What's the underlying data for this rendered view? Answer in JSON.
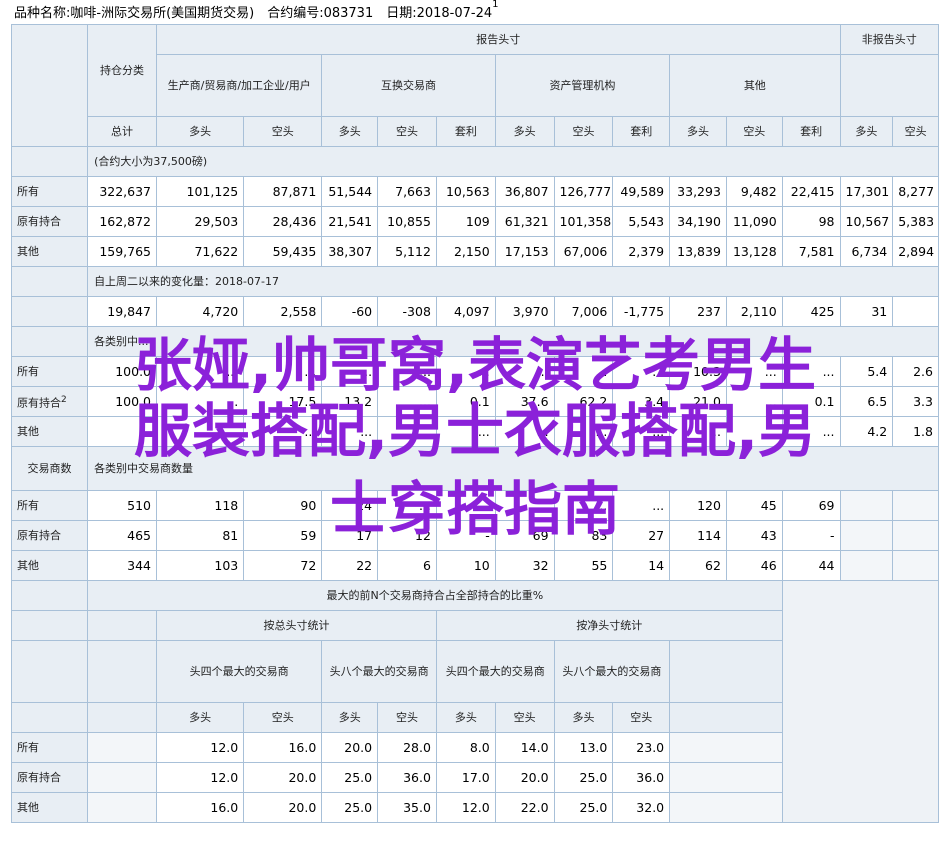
{
  "header": {
    "text": "品种名称:咖啡-洲际交易所(美国期货交易)　合约编号:083731　日期:2018-07-24",
    "marker": "1"
  },
  "col_headers": {
    "holding_class": "持仓分类",
    "reportable": "报告头寸",
    "non_reportable": "非报告头寸",
    "producer": "生产商/贸易商/加工企业/用户",
    "swap": "互换交易商",
    "managed_money": "资产管理机构",
    "other": "其他",
    "total": "总计",
    "long": "多头",
    "short": "空头",
    "spread": "套利"
  },
  "section1": {
    "note": "(合约大小为37,500磅)",
    "rows": [
      {
        "label": "所有",
        "values": [
          "322,637",
          "101,125",
          "87,871",
          "51,544",
          "7,663",
          "10,563",
          "36,807",
          "126,777",
          "49,589",
          "33,293",
          "9,482",
          "22,415",
          "17,301",
          "8,277"
        ]
      },
      {
        "label": "原有持合",
        "values": [
          "162,872",
          "29,503",
          "28,436",
          "21,541",
          "10,855",
          "109",
          "61,321",
          "101,358",
          "5,543",
          "34,190",
          "11,090",
          "98",
          "10,567",
          "5,383"
        ]
      },
      {
        "label": "其他",
        "values": [
          "159,765",
          "71,622",
          "59,435",
          "38,307",
          "5,112",
          "2,150",
          "17,153",
          "67,006",
          "2,379",
          "13,839",
          "13,128",
          "7,581",
          "6,734",
          "2,894"
        ]
      }
    ]
  },
  "section2": {
    "note": "自上周二以来的变化量：2018-07-17",
    "values": [
      "19,847",
      "4,720",
      "2,558",
      "-60",
      "-308",
      "4,097",
      "3,970",
      "7,006",
      "-1,775",
      "237",
      "2,110",
      "425",
      "31"
    ]
  },
  "section3": {
    "note": "各类别中...",
    "rows": [
      {
        "label": "所有",
        "values": [
          "100.0",
          "...",
          "...",
          "...",
          "...",
          "...",
          "...",
          "...",
          "...",
          "10.3",
          "...",
          "...",
          "5.4",
          "2.6"
        ]
      },
      {
        "label": "原有持合",
        "marker": "2",
        "values": [
          "100.0",
          "...",
          "17.5",
          "13.2",
          "...",
          "0.1",
          "37.6",
          "62.2",
          "3.4",
          "21.0",
          "...",
          "0.1",
          "6.5",
          "3.3"
        ]
      },
      {
        "label": "其他",
        "values": [
          "...",
          "...",
          "...",
          "...",
          "...",
          "...",
          "...",
          "...",
          "...",
          "...",
          "...",
          "...",
          "4.2",
          "1.8"
        ]
      }
    ]
  },
  "section4": {
    "left_header": "交易商数",
    "note": "各类别中交易商数量",
    "rows": [
      {
        "label": "所有",
        "values": [
          "510",
          "118",
          "90",
          "24",
          "...",
          "...",
          "...",
          "...",
          "...",
          "120",
          "45",
          "69",
          "",
          ""
        ]
      },
      {
        "label": "原有持合",
        "values": [
          "465",
          "81",
          "59",
          "17",
          "12",
          "-",
          "69",
          "83",
          "27",
          "114",
          "43",
          "-",
          "",
          ""
        ]
      },
      {
        "label": "其他",
        "values": [
          "344",
          "103",
          "72",
          "22",
          "6",
          "10",
          "32",
          "55",
          "14",
          "62",
          "46",
          "44",
          "",
          ""
        ]
      }
    ]
  },
  "section5": {
    "title": "最大的前N个交易商持合占全部持合的比重%",
    "by_gross": "按总头寸统计",
    "by_net": "按净头寸统计",
    "top4": "头四个最大的交易商",
    "top8": "头八个最大的交易商",
    "rows": [
      {
        "label": "所有",
        "values": [
          "12.0",
          "16.0",
          "20.0",
          "28.0",
          "8.0",
          "14.0",
          "13.0",
          "23.0"
        ]
      },
      {
        "label": "原有持合",
        "values": [
          "12.0",
          "20.0",
          "25.0",
          "36.0",
          "17.0",
          "20.0",
          "25.0",
          "36.0"
        ]
      },
      {
        "label": "其他",
        "values": [
          "16.0",
          "20.0",
          "25.0",
          "35.0",
          "12.0",
          "22.0",
          "25.0",
          "32.0"
        ]
      }
    ]
  },
  "overlay": {
    "line1": "张娅,帅哥窝,表演艺考男生",
    "line2": "服装搭配,男士衣服搭配,男",
    "line3": "士穿搭指南"
  },
  "colors": {
    "header_bg": "#e8eef4",
    "border": "#a8c0d8",
    "overlay": "#8b21d9"
  }
}
